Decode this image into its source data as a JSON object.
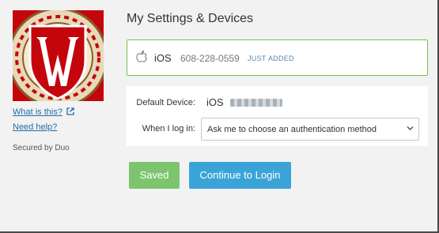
{
  "sidebar": {
    "help_link": "What is this?",
    "need_help": "Need help?",
    "secured_by": "Secured by Duo"
  },
  "main": {
    "title": "My Settings & Devices",
    "device": {
      "os": "iOS",
      "phone": "608-228-0559",
      "badge": "JUST ADDED"
    },
    "settings": {
      "default_label": "Default Device:",
      "default_value": "iOS",
      "login_label": "When I log in:",
      "login_select_value": "Ask me to choose an authentication method"
    },
    "buttons": {
      "saved": "Saved",
      "continue": "Continue to Login"
    }
  },
  "colors": {
    "device_border": "#76c14b",
    "saved_button": "#7dc46f",
    "continue_button": "#3aa4d8",
    "link": "#1f6ea8",
    "logo_red": "#c5050c"
  },
  "icons": {
    "apple": "apple-icon",
    "external": "external-link-icon",
    "dropdown": "chevron-down-icon"
  }
}
